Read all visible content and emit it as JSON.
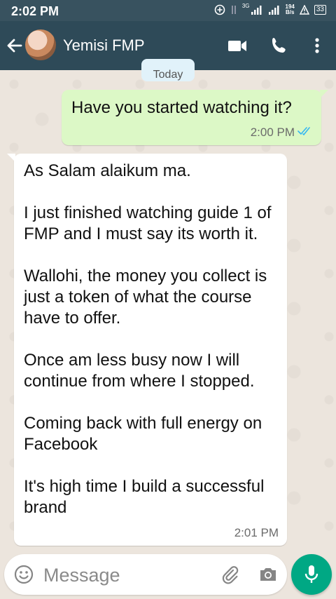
{
  "status_bar": {
    "time": "2:02 PM",
    "network_label": "3G",
    "net_speed_value": "194",
    "net_speed_unit": "B/s",
    "battery": "33",
    "icons": [
      "add-circle-icon",
      "data-arrows-icon",
      "signal-icon",
      "signal-icon",
      "alert-icon",
      "battery-icon"
    ]
  },
  "header": {
    "contact_name": "Yemisi FMP",
    "icons": [
      "back-arrow-icon",
      "video-call-icon",
      "phone-icon",
      "more-vert-icon"
    ]
  },
  "chat": {
    "date_chip": "Today",
    "messages": [
      {
        "direction": "outgoing",
        "text": "Have you started watching it?",
        "time": "2:00 PM",
        "status": "read"
      },
      {
        "direction": "incoming",
        "text": "As Salam alaikum ma.\n\nI just finished watching guide 1 of FMP and I must say its worth it.\n\nWallohi, the money you collect is just a token of what the course have to offer.\n\nOnce am less busy now I will continue from where I stopped.\n\nComing back with full energy on Facebook\n\nIt's high time I build a successful brand",
        "time": "2:01 PM"
      }
    ]
  },
  "composer": {
    "placeholder": "Message",
    "icons": [
      "emoji-icon",
      "attach-icon",
      "camera-icon",
      "mic-icon"
    ]
  },
  "colors": {
    "header": "#2e4a58",
    "outgoing_bubble": "#dcf8c6",
    "incoming_bubble": "#ffffff",
    "accent": "#00a884",
    "read_ticks": "#34b7f1"
  }
}
